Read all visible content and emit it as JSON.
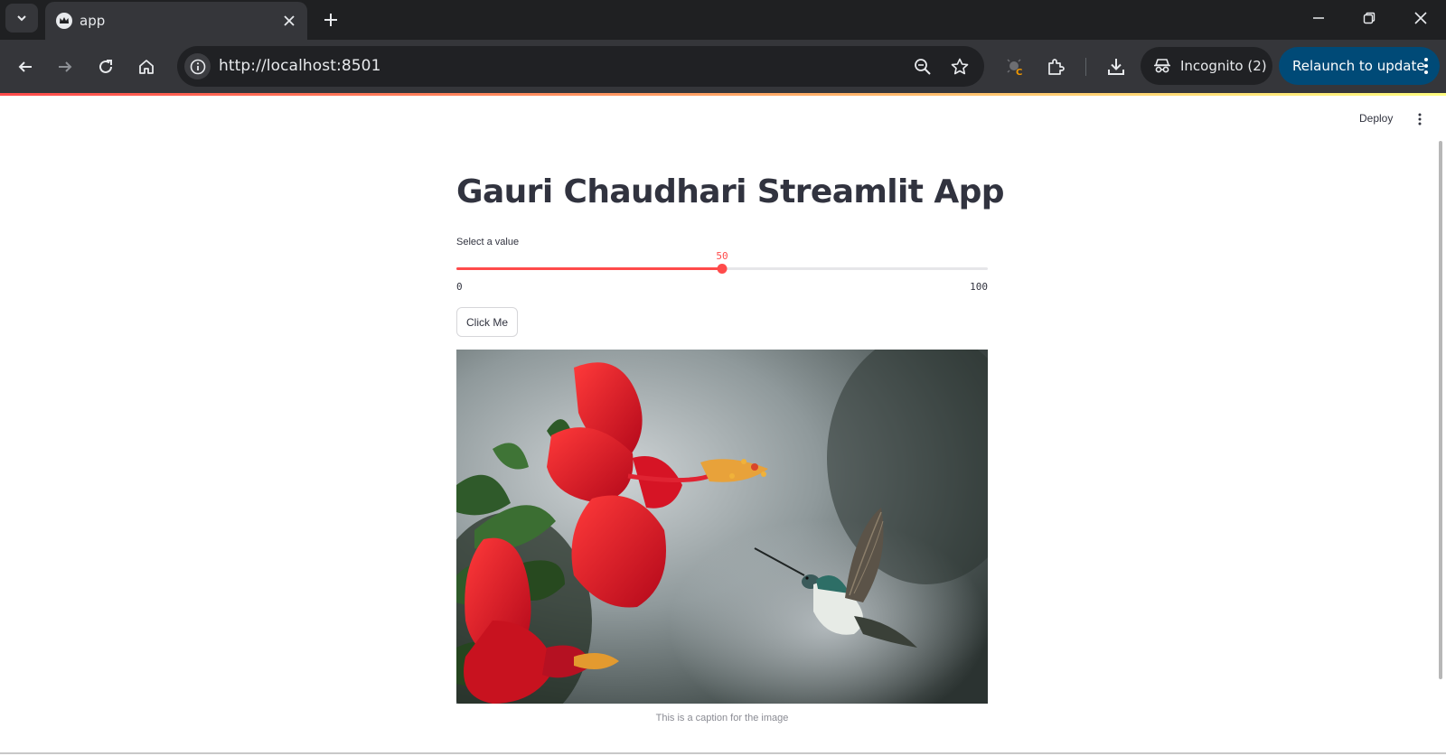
{
  "browser": {
    "tab": {
      "title": "app"
    },
    "address_bar": {
      "url": "http://localhost:8501"
    },
    "incognito_label": "Incognito (2)",
    "relaunch_label": "Relaunch to update"
  },
  "header": {
    "deploy_label": "Deploy"
  },
  "main": {
    "title": "Gauri Chaudhari Streamlit App",
    "slider": {
      "label": "Select a value",
      "min": 0,
      "max": 100,
      "value": 50,
      "min_label": "0",
      "max_label": "100",
      "value_label": "50",
      "accent_color": "#ff4b4b"
    },
    "button": {
      "label": "Click Me"
    },
    "image": {
      "icons": [
        "hibiscus-flower",
        "hummingbird"
      ],
      "caption": "This is a caption for the image"
    }
  },
  "colors": {
    "chrome_dark": "#1f2022",
    "toolbar": "#35363a",
    "relaunch_bg": "#004a77",
    "text_primary": "#31333f",
    "streamlit_red": "#ff4b4b"
  }
}
